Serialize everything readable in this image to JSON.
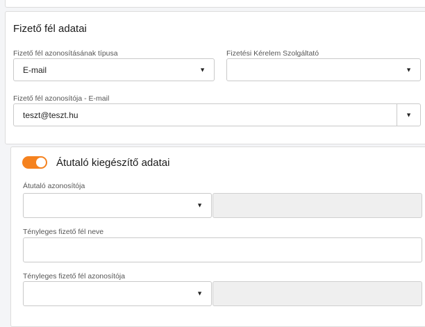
{
  "payer_section": {
    "title": "Fizető fél adatai",
    "id_type": {
      "label": "Fizető fél azonosításának típusa",
      "value": "E-mail",
      "caret": "▼"
    },
    "provider": {
      "label": "Fizetési Kérelem Szolgáltató",
      "value": "",
      "caret": "▼"
    },
    "id_value": {
      "label": "Fizető fél azonosítója - E-mail",
      "value": "teszt@teszt.hu",
      "caret": "▼"
    }
  },
  "transferor_section": {
    "title": "Átutaló kiegészítő adatai",
    "toggle_on": true,
    "accent_color": "#f5821f",
    "transferor_id": {
      "label": "Átutaló azonosítója",
      "caret": "▼"
    },
    "actual_payer_name": {
      "label": "Tényleges fizető fél neve",
      "value": ""
    },
    "actual_payer_id": {
      "label": "Tényleges fizető fél azonosítója",
      "caret": "▼"
    }
  }
}
